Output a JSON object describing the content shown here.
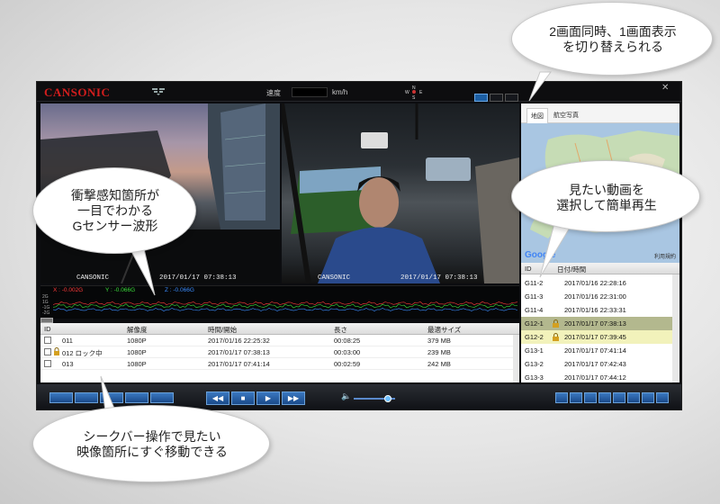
{
  "app": {
    "logo": "CANSONIC",
    "speed_label": "速度",
    "speed_unit": "km/h",
    "compass_letters": [
      "N",
      "W",
      "E",
      "S"
    ]
  },
  "videos": {
    "left_caption_brand": "CANSONIC",
    "left_caption_time": "2017/01/17 07:38:13",
    "right_caption_brand": "CANSONIC",
    "right_caption_time": "2017/01/17 07:38:13"
  },
  "map": {
    "tabs": [
      "地図",
      "航空写真"
    ],
    "google_logo": "Google",
    "terms": "利用規約"
  },
  "gsensor": {
    "x_label": "X : -0.002G",
    "y_label": "Y : -0.066G",
    "z_label": "Z : -0.066G",
    "axis": [
      "2G",
      "1G",
      "-1G",
      "-2G"
    ],
    "x_color": "#ff3a3a",
    "y_color": "#3adf3a",
    "z_color": "#3a8cff"
  },
  "file_list": {
    "columns": [
      "ID",
      "解像度",
      "時間/開始",
      "長さ",
      "最適サイズ"
    ],
    "rows": [
      {
        "id": "011",
        "res": "1080P",
        "start": "2017/01/16 22:25:32",
        "length": "00:08:25",
        "size": "379 MB",
        "locked": false
      },
      {
        "id": "012 ロック中",
        "res": "1080P",
        "start": "2017/01/17 07:38:13",
        "length": "00:03:00",
        "size": "239 MB",
        "locked": true
      },
      {
        "id": "013",
        "res": "1080P",
        "start": "2017/01/17 07:41:14",
        "length": "00:02:59",
        "size": "242 MB",
        "locked": false
      }
    ]
  },
  "trip_list": {
    "columns": [
      "ID",
      "日付/時間"
    ],
    "rows": [
      {
        "id": "G11-2",
        "time": "2017/01/16 22:28:16",
        "locked": false,
        "highlight": ""
      },
      {
        "id": "G11-3",
        "time": "2017/01/16 22:31:00",
        "locked": false,
        "highlight": ""
      },
      {
        "id": "G11-4",
        "time": "2017/01/16 22:33:31",
        "locked": false,
        "highlight": ""
      },
      {
        "id": "G12-1",
        "time": "2017/01/17 07:38:13",
        "locked": true,
        "highlight": "selected"
      },
      {
        "id": "G12-2",
        "time": "2017/01/17 07:39:45",
        "locked": true,
        "highlight": "light"
      },
      {
        "id": "G13-1",
        "time": "2017/01/17 07:41:14",
        "locked": false,
        "highlight": ""
      },
      {
        "id": "G13-2",
        "time": "2017/01/17 07:42:43",
        "locked": false,
        "highlight": ""
      },
      {
        "id": "G13-3",
        "time": "2017/01/17 07:44:12",
        "locked": false,
        "highlight": ""
      }
    ]
  },
  "controls": {
    "rewind": "◀◀",
    "stop": "■",
    "play": "▶",
    "forward": "▶▶",
    "volume_icon": "🔈",
    "volume_level": 0.82
  },
  "callouts": {
    "top_right": "2画面同時、1画面表示\nを切り替えられる",
    "middle_left": "衝撃感知箇所が\n一目でわかる\nGセンサー波形",
    "middle_right": "見たい動画を\n選択して簡単再生",
    "bottom_left": "シークバー操作で見たい\n映像箇所にすぐ移動できる"
  }
}
